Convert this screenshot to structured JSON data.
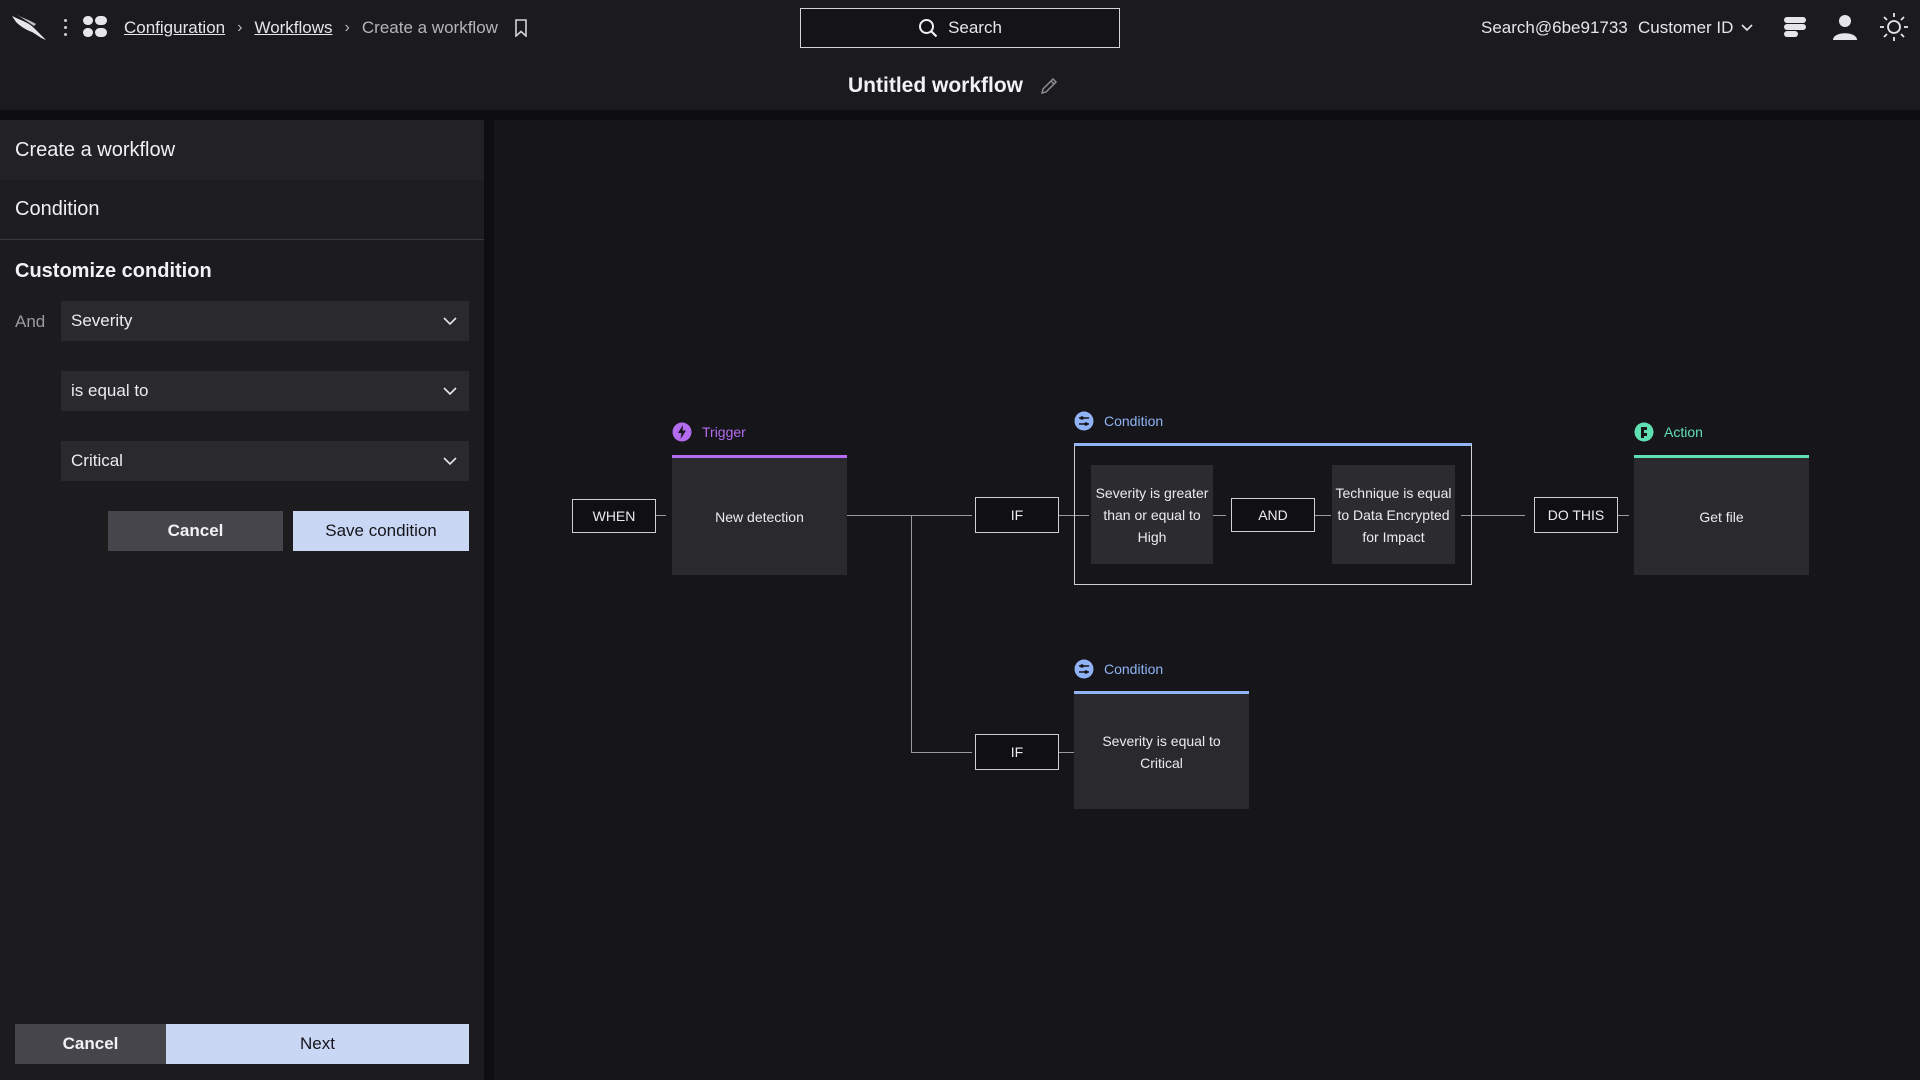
{
  "topbar": {
    "breadcrumb": [
      {
        "label": "Configuration"
      },
      {
        "label": "Workflows"
      },
      {
        "label": "Create a workflow"
      }
    ],
    "search_label": "Search",
    "user": "Search@6be91733",
    "customer_id_label": "Customer ID",
    "page_title": "Untitled workflow",
    "icons": [
      "falcon-logo-icon",
      "kebab-menu-icon",
      "apps-menu-icon",
      "bookmark-icon",
      "search-icon",
      "chevron-down-icon",
      "switch-icon",
      "user-icon",
      "theme-sun-icon",
      "pencil-icon"
    ]
  },
  "panel": {
    "header": "Create a workflow",
    "section": "Condition",
    "customize_title": "Customize condition",
    "and_label": "And",
    "field_value": "Severity",
    "operator_value": "is equal to",
    "value_value": "Critical",
    "cancel_label": "Cancel",
    "save_label": "Save condition",
    "footer_cancel_label": "Cancel",
    "footer_next_label": "Next"
  },
  "canvas": {
    "when_label": "WHEN",
    "trigger_label": "Trigger",
    "trigger_node": "New detection",
    "if_label_1": "IF",
    "condition_label_1": "Condition",
    "cond_a": "Severity is greater than or equal to High",
    "and_label": "AND",
    "cond_b": "Technique is equal to Data Encrypted for Impact",
    "do_this_label": "DO THIS",
    "action_label": "Action",
    "action_node": "Get file",
    "if_label_2": "IF",
    "condition_label_2": "Condition",
    "cond_c": "Severity is equal to Critical"
  },
  "colors": {
    "trigger": "#b36cf0",
    "condition": "#8fb3f5",
    "action": "#5fe0b3",
    "primary_button": "#c9d7f5"
  }
}
